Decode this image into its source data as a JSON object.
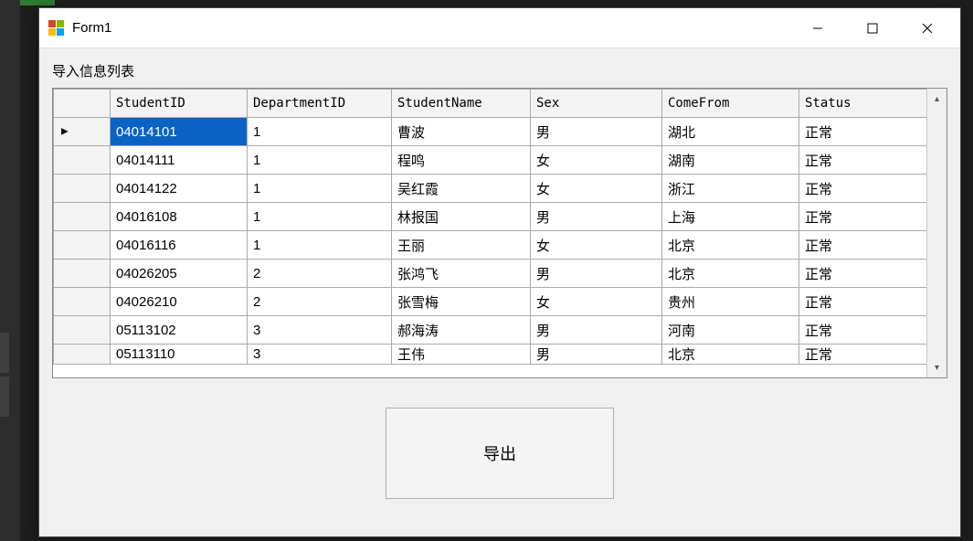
{
  "window": {
    "title": "Form1"
  },
  "label": {
    "caption": "导入信息列表"
  },
  "grid": {
    "columns": [
      "StudentID",
      "DepartmentID",
      "StudentName",
      "Sex",
      "ComeFrom",
      "Status"
    ],
    "rows": [
      {
        "StudentID": "04014101",
        "DepartmentID": "1",
        "StudentName": "曹波",
        "Sex": "男",
        "ComeFrom": "湖北",
        "Status": "正常"
      },
      {
        "StudentID": "04014111",
        "DepartmentID": "1",
        "StudentName": "程鸣",
        "Sex": "女",
        "ComeFrom": "湖南",
        "Status": "正常"
      },
      {
        "StudentID": "04014122",
        "DepartmentID": "1",
        "StudentName": "吴红霞",
        "Sex": "女",
        "ComeFrom": "浙江",
        "Status": "正常"
      },
      {
        "StudentID": "04016108",
        "DepartmentID": "1",
        "StudentName": "林报国",
        "Sex": "男",
        "ComeFrom": "上海",
        "Status": "正常"
      },
      {
        "StudentID": "04016116",
        "DepartmentID": "1",
        "StudentName": "王丽",
        "Sex": "女",
        "ComeFrom": "北京",
        "Status": "正常"
      },
      {
        "StudentID": "04026205",
        "DepartmentID": "2",
        "StudentName": "张鸿飞",
        "Sex": "男",
        "ComeFrom": "北京",
        "Status": "正常"
      },
      {
        "StudentID": "04026210",
        "DepartmentID": "2",
        "StudentName": "张雪梅",
        "Sex": "女",
        "ComeFrom": "贵州",
        "Status": "正常"
      },
      {
        "StudentID": "05113102",
        "DepartmentID": "3",
        "StudentName": "郝海涛",
        "Sex": "男",
        "ComeFrom": "河南",
        "Status": "正常"
      },
      {
        "StudentID": "05113110",
        "DepartmentID": "3",
        "StudentName": "王伟",
        "Sex": "男",
        "ComeFrom": "北京",
        "Status": "正常"
      }
    ],
    "selected_row": 0,
    "selected_col": "StudentID"
  },
  "buttons": {
    "export": "导出"
  }
}
